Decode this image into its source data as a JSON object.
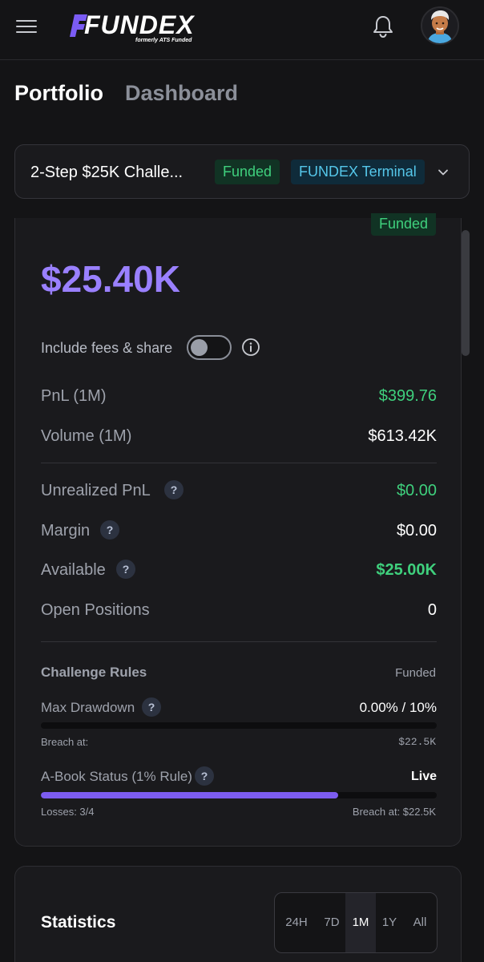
{
  "header": {
    "logo_text": "FUNDEX",
    "logo_subtext": "formerly ATS Funded",
    "icons": [
      "menu-icon",
      "bell-icon",
      "avatar"
    ]
  },
  "page_tabs": [
    {
      "label": "Portfolio",
      "active": true
    },
    {
      "label": "Dashboard",
      "active": false
    }
  ],
  "account_selector": {
    "name": "2-Step $25K Challe...",
    "status_badge": "Funded",
    "platform_badge": "FUNDEX Terminal"
  },
  "overview": {
    "status_badge": "Funded",
    "balance": "$25.40K",
    "toggle_label": "Include fees & share",
    "toggle_on": false,
    "rows": [
      {
        "label": "PnL (1M)",
        "value": "$399.76",
        "help": false
      },
      {
        "label": "Volume (1M)",
        "value": "$613.42K",
        "help": false
      },
      {
        "label": "Unrealized PnL",
        "value": "$0.00",
        "help": true
      },
      {
        "label": "Margin",
        "value": "$0.00",
        "help": true
      },
      {
        "label": "Available",
        "value": "$25.00K",
        "help": true
      },
      {
        "label": "Open Positions",
        "value": "0",
        "help": false
      }
    ],
    "help_glyph": "?"
  },
  "challenge_rules": {
    "title": "Challenge Rules",
    "status": "Funded",
    "max_drawdown": {
      "label": "Max Drawdown",
      "value": "0.00% / 10%",
      "progress": 0.0,
      "breach_label": "Breach at:",
      "breach_value": "$22.5K"
    },
    "abook": {
      "label": "A-Book Status (1% Rule)",
      "value": "Live",
      "progress": 0.75,
      "losses": "Losses: 3/4",
      "breach": "Breach at: $22.5K"
    }
  },
  "statistics": {
    "title": "Statistics",
    "ranges": [
      "24H",
      "7D",
      "1M",
      "1Y",
      "All"
    ],
    "active_range": "1M"
  },
  "colors": {
    "background": "#141416",
    "card": "#1a1a1d",
    "accent_purple": "#9a80ff",
    "green": "#3fd07d",
    "cyan": "#55c7ea"
  }
}
